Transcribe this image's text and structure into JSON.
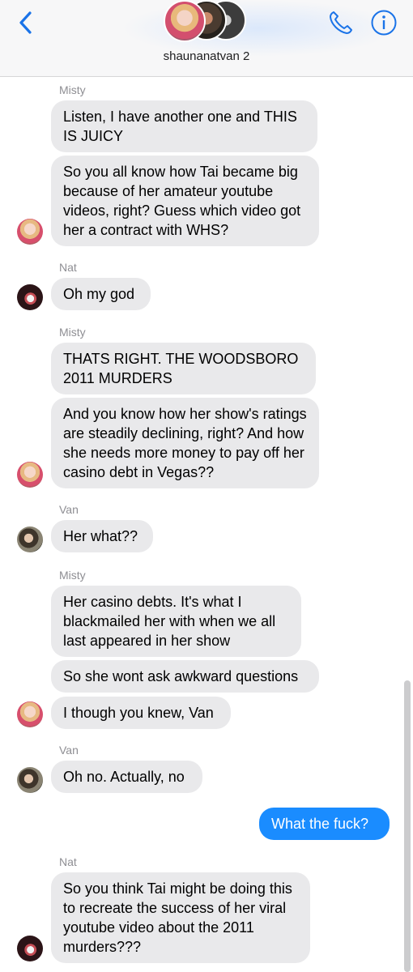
{
  "header": {
    "group_name": "shaunanatvan 2",
    "back_icon": "chevron-left-icon",
    "call_icon": "phone-icon",
    "info_icon": "info-icon",
    "accent_color": "#1a73e8"
  },
  "messages": [
    {
      "type": "sender",
      "text": "Misty"
    },
    {
      "type": "bubble",
      "text": "Listen, I have another one and THIS IS JUICY"
    },
    {
      "type": "bubble",
      "text": "So you all know how Tai became big because of her amateur youtube videos, right? Guess which video got her a contract with WHS?"
    },
    {
      "type": "sender",
      "text": "Nat"
    },
    {
      "type": "bubble",
      "text": "Oh my god"
    },
    {
      "type": "sender",
      "text": "Misty"
    },
    {
      "type": "bubble",
      "text": "THATS RIGHT. THE WOODSBORO 2011 MURDERS"
    },
    {
      "type": "bubble",
      "text": "And you know how her show's ratings are steadily declining, right? And how she needs more money to pay off her casino debt in Vegas??"
    },
    {
      "type": "sender",
      "text": "Van"
    },
    {
      "type": "bubble",
      "text": "Her what??"
    },
    {
      "type": "sender",
      "text": "Misty"
    },
    {
      "type": "bubble",
      "text": "Her casino debts. It's what I blackmailed her with when we all last appeared in her show"
    },
    {
      "type": "bubble",
      "text": "So she wont ask awkward questions"
    },
    {
      "type": "bubble",
      "text": "I though you knew, Van"
    },
    {
      "type": "sender",
      "text": "Van"
    },
    {
      "type": "bubble",
      "text": "Oh no. Actually, no"
    },
    {
      "type": "bubble",
      "text": "What the fuck?",
      "outgoing": true
    },
    {
      "type": "sender",
      "text": "Nat"
    },
    {
      "type": "bubble",
      "text": "So you think Tai might be doing this to recreate the success of her viral youtube video about the 2011 murders???"
    }
  ],
  "colors": {
    "incoming_bubble": "#e9e9eb",
    "outgoing_bubble": "#1a8cff",
    "sender_name": "#8e8e93"
  }
}
